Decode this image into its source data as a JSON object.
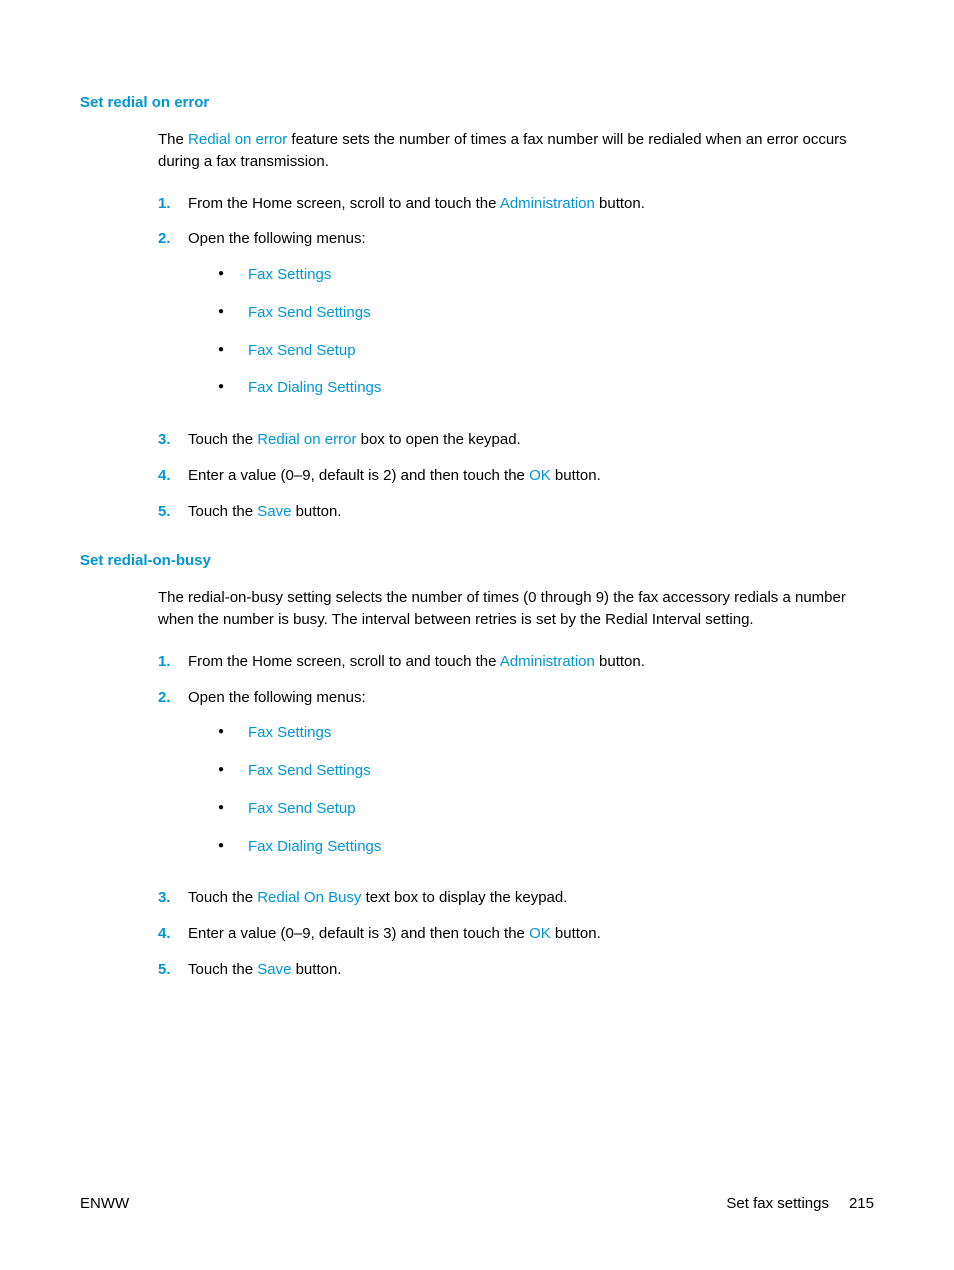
{
  "sections": [
    {
      "heading": "Set redial on error",
      "intro_parts": [
        "The ",
        "Redial on error",
        " feature sets the number of times a fax number will be redialed when an error occurs during a fax transmission."
      ],
      "steps": [
        {
          "num": "1.",
          "parts": [
            "From the Home screen, scroll to and touch the ",
            "Administration",
            " button."
          ]
        },
        {
          "num": "2.",
          "parts": [
            "Open the following menus:"
          ],
          "bullets": [
            "Fax Settings",
            "Fax Send Settings",
            "Fax Send Setup",
            "Fax Dialing Settings"
          ]
        },
        {
          "num": "3.",
          "parts": [
            "Touch the ",
            "Redial on error",
            " box to open the keypad."
          ]
        },
        {
          "num": "4.",
          "parts": [
            "Enter a value (0–9, default is 2) and then touch the ",
            "OK",
            " button."
          ]
        },
        {
          "num": "5.",
          "parts": [
            "Touch the ",
            "Save",
            " button."
          ]
        }
      ]
    },
    {
      "heading": "Set redial-on-busy",
      "intro_parts": [
        "The redial-on-busy setting selects the number of times (0 through 9) the fax accessory redials a number when the number is busy. The interval between retries is set by the Redial Interval setting."
      ],
      "steps": [
        {
          "num": "1.",
          "parts": [
            "From the Home screen, scroll to and touch the ",
            "Administration",
            " button."
          ]
        },
        {
          "num": "2.",
          "parts": [
            "Open the following menus:"
          ],
          "bullets": [
            "Fax Settings",
            "Fax Send Settings",
            "Fax Send Setup",
            "Fax Dialing Settings"
          ]
        },
        {
          "num": "3.",
          "parts": [
            "Touch the ",
            "Redial On Busy",
            " text box to display the keypad."
          ]
        },
        {
          "num": "4.",
          "parts": [
            "Enter a value (0–9, default is 3) and then touch the ",
            "OK",
            " button."
          ]
        },
        {
          "num": "5.",
          "parts": [
            "Touch the ",
            "Save",
            " button."
          ]
        }
      ]
    }
  ],
  "footer": {
    "left": "ENWW",
    "right_label": "Set fax settings",
    "page_number": "215"
  }
}
